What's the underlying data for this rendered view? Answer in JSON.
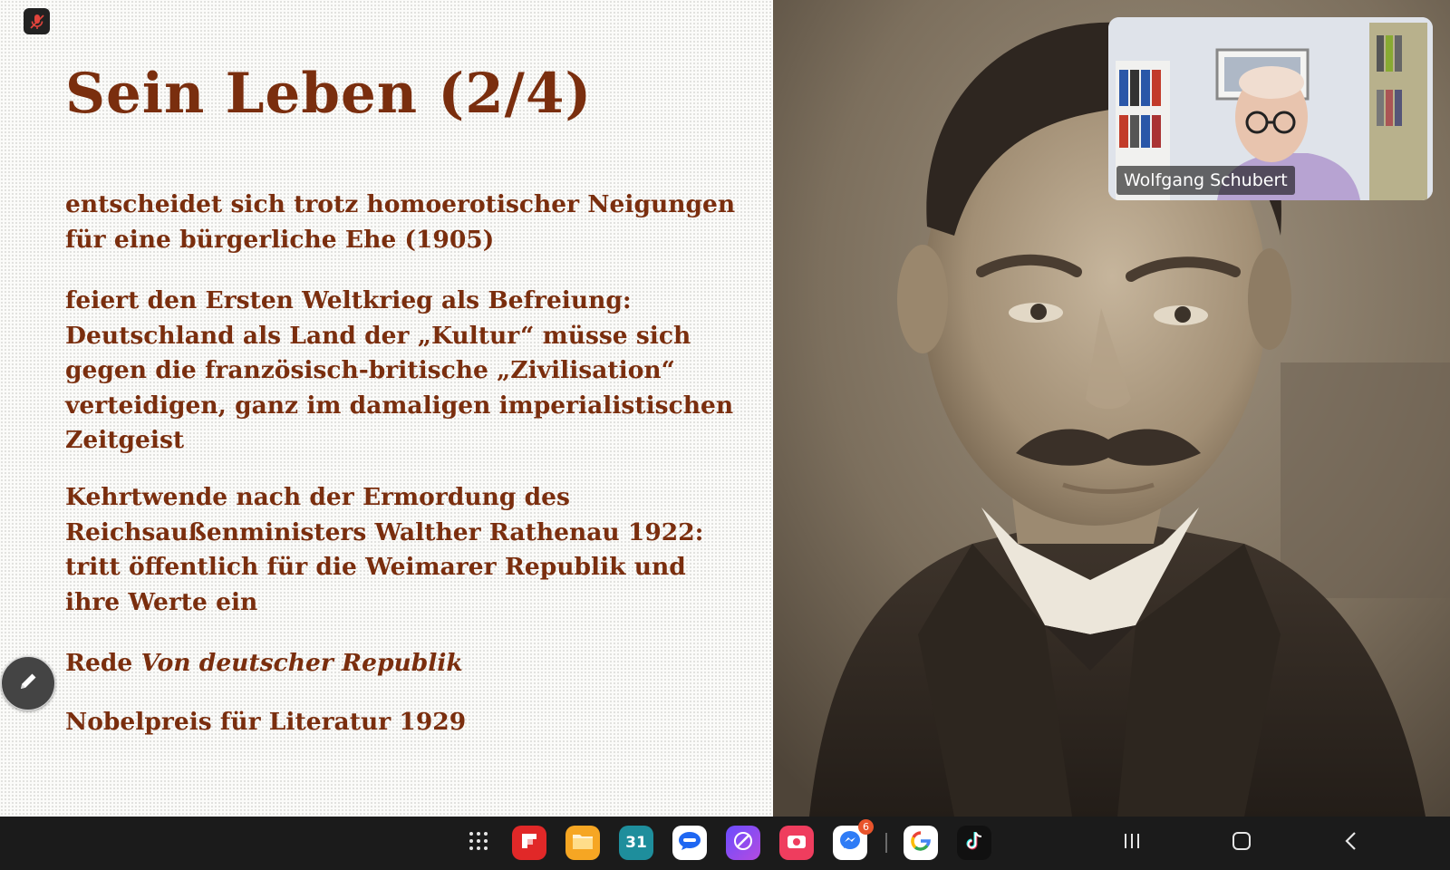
{
  "slide": {
    "title": "Sein Leben (2/4)",
    "paragraphs": [
      "entscheidet sich trotz homoerotischer Neigungen\nfür eine bürgerliche Ehe (1905)",
      "feiert den Ersten Weltkrieg als Befreiung:\nDeutschland als Land der „Kultur“ müsse sich\ngegen die französisch-britische „Zivilisation“\nverteidigen, ganz im damaligen imperialistischen\nZeitgeist",
      "Kehrtwende nach der Ermordung des\nReichsaußenministers Walther Rathenau 1922:\ntritt  öffentlich für die Weimarer Republik und\nihre Werte ein"
    ],
    "speech_prefix": "Rede ",
    "speech_title": "Von deutscher Republik",
    "nobel": "Nobelpreis für Literatur 1929",
    "text_color": "#7a2e0e"
  },
  "video": {
    "participant_name": "Wolfgang Schubert",
    "mic_state": "muted"
  },
  "taskbar": {
    "apps": [
      {
        "name": "app-drawer",
        "icon": "grid-icon"
      },
      {
        "name": "flipboard",
        "icon": "flipboard-icon",
        "color": "#e12828"
      },
      {
        "name": "files",
        "icon": "folder-icon",
        "color": "#f6a623"
      },
      {
        "name": "calendar",
        "icon": "calendar-icon",
        "color": "#1e8e9c",
        "label": "31"
      },
      {
        "name": "messages",
        "icon": "chat-icon",
        "color": "#ffffff"
      },
      {
        "name": "internet",
        "icon": "browser-icon",
        "color": "#7e57ff"
      },
      {
        "name": "screen-recorder",
        "icon": "camera-icon",
        "color": "#ef3d5e"
      },
      {
        "name": "messenger",
        "icon": "messenger-icon",
        "color": "#ffffff",
        "badge": "6"
      },
      {
        "name": "google",
        "icon": "google-icon",
        "color": "#ffffff"
      },
      {
        "name": "tiktok",
        "icon": "tiktok-icon",
        "color": "#111111"
      }
    ],
    "nav": [
      "recents",
      "home",
      "back"
    ]
  }
}
